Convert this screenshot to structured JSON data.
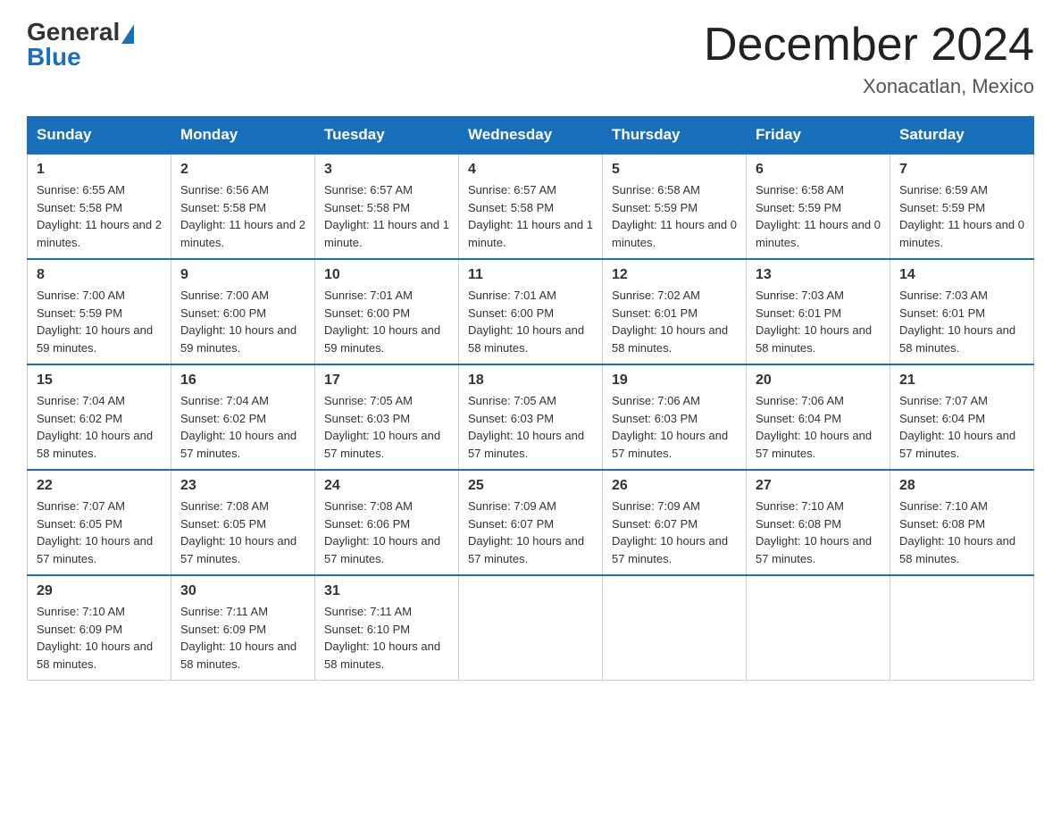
{
  "header": {
    "logo_general": "General",
    "logo_blue": "Blue",
    "month_title": "December 2024",
    "location": "Xonacatlan, Mexico"
  },
  "days_of_week": [
    "Sunday",
    "Monday",
    "Tuesday",
    "Wednesday",
    "Thursday",
    "Friday",
    "Saturday"
  ],
  "weeks": [
    [
      {
        "day": "1",
        "sunrise": "6:55 AM",
        "sunset": "5:58 PM",
        "daylight": "11 hours and 2 minutes."
      },
      {
        "day": "2",
        "sunrise": "6:56 AM",
        "sunset": "5:58 PM",
        "daylight": "11 hours and 2 minutes."
      },
      {
        "day": "3",
        "sunrise": "6:57 AM",
        "sunset": "5:58 PM",
        "daylight": "11 hours and 1 minute."
      },
      {
        "day": "4",
        "sunrise": "6:57 AM",
        "sunset": "5:58 PM",
        "daylight": "11 hours and 1 minute."
      },
      {
        "day": "5",
        "sunrise": "6:58 AM",
        "sunset": "5:59 PM",
        "daylight": "11 hours and 0 minutes."
      },
      {
        "day": "6",
        "sunrise": "6:58 AM",
        "sunset": "5:59 PM",
        "daylight": "11 hours and 0 minutes."
      },
      {
        "day": "7",
        "sunrise": "6:59 AM",
        "sunset": "5:59 PM",
        "daylight": "11 hours and 0 minutes."
      }
    ],
    [
      {
        "day": "8",
        "sunrise": "7:00 AM",
        "sunset": "5:59 PM",
        "daylight": "10 hours and 59 minutes."
      },
      {
        "day": "9",
        "sunrise": "7:00 AM",
        "sunset": "6:00 PM",
        "daylight": "10 hours and 59 minutes."
      },
      {
        "day": "10",
        "sunrise": "7:01 AM",
        "sunset": "6:00 PM",
        "daylight": "10 hours and 59 minutes."
      },
      {
        "day": "11",
        "sunrise": "7:01 AM",
        "sunset": "6:00 PM",
        "daylight": "10 hours and 58 minutes."
      },
      {
        "day": "12",
        "sunrise": "7:02 AM",
        "sunset": "6:01 PM",
        "daylight": "10 hours and 58 minutes."
      },
      {
        "day": "13",
        "sunrise": "7:03 AM",
        "sunset": "6:01 PM",
        "daylight": "10 hours and 58 minutes."
      },
      {
        "day": "14",
        "sunrise": "7:03 AM",
        "sunset": "6:01 PM",
        "daylight": "10 hours and 58 minutes."
      }
    ],
    [
      {
        "day": "15",
        "sunrise": "7:04 AM",
        "sunset": "6:02 PM",
        "daylight": "10 hours and 58 minutes."
      },
      {
        "day": "16",
        "sunrise": "7:04 AM",
        "sunset": "6:02 PM",
        "daylight": "10 hours and 57 minutes."
      },
      {
        "day": "17",
        "sunrise": "7:05 AM",
        "sunset": "6:03 PM",
        "daylight": "10 hours and 57 minutes."
      },
      {
        "day": "18",
        "sunrise": "7:05 AM",
        "sunset": "6:03 PM",
        "daylight": "10 hours and 57 minutes."
      },
      {
        "day": "19",
        "sunrise": "7:06 AM",
        "sunset": "6:03 PM",
        "daylight": "10 hours and 57 minutes."
      },
      {
        "day": "20",
        "sunrise": "7:06 AM",
        "sunset": "6:04 PM",
        "daylight": "10 hours and 57 minutes."
      },
      {
        "day": "21",
        "sunrise": "7:07 AM",
        "sunset": "6:04 PM",
        "daylight": "10 hours and 57 minutes."
      }
    ],
    [
      {
        "day": "22",
        "sunrise": "7:07 AM",
        "sunset": "6:05 PM",
        "daylight": "10 hours and 57 minutes."
      },
      {
        "day": "23",
        "sunrise": "7:08 AM",
        "sunset": "6:05 PM",
        "daylight": "10 hours and 57 minutes."
      },
      {
        "day": "24",
        "sunrise": "7:08 AM",
        "sunset": "6:06 PM",
        "daylight": "10 hours and 57 minutes."
      },
      {
        "day": "25",
        "sunrise": "7:09 AM",
        "sunset": "6:07 PM",
        "daylight": "10 hours and 57 minutes."
      },
      {
        "day": "26",
        "sunrise": "7:09 AM",
        "sunset": "6:07 PM",
        "daylight": "10 hours and 57 minutes."
      },
      {
        "day": "27",
        "sunrise": "7:10 AM",
        "sunset": "6:08 PM",
        "daylight": "10 hours and 57 minutes."
      },
      {
        "day": "28",
        "sunrise": "7:10 AM",
        "sunset": "6:08 PM",
        "daylight": "10 hours and 58 minutes."
      }
    ],
    [
      {
        "day": "29",
        "sunrise": "7:10 AM",
        "sunset": "6:09 PM",
        "daylight": "10 hours and 58 minutes."
      },
      {
        "day": "30",
        "sunrise": "7:11 AM",
        "sunset": "6:09 PM",
        "daylight": "10 hours and 58 minutes."
      },
      {
        "day": "31",
        "sunrise": "7:11 AM",
        "sunset": "6:10 PM",
        "daylight": "10 hours and 58 minutes."
      },
      null,
      null,
      null,
      null
    ]
  ]
}
